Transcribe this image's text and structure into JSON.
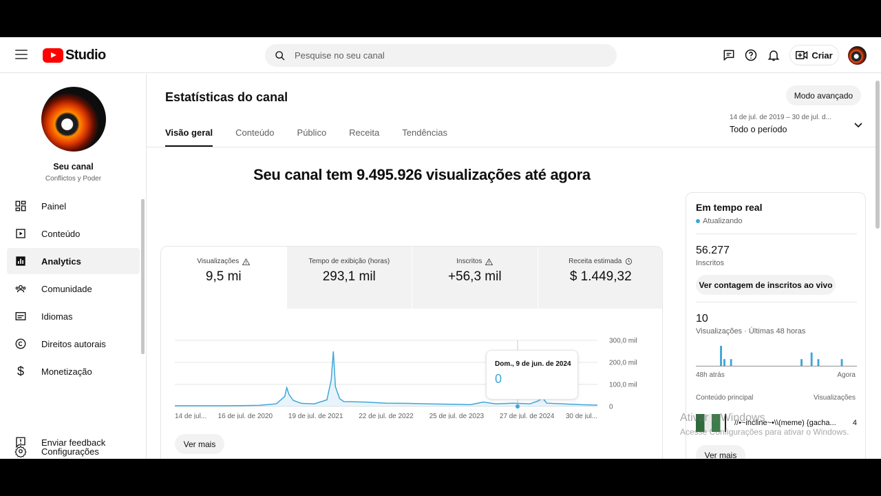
{
  "header": {
    "logo_text": "Studio",
    "search_placeholder": "Pesquise no seu canal",
    "create_label": "Criar"
  },
  "sidebar": {
    "channel_name": "Seu canal",
    "channel_subtitle": "Conflictos y Poder",
    "items": [
      {
        "label": "Painel",
        "icon": "dashboard-icon"
      },
      {
        "label": "Conteúdo",
        "icon": "content-icon"
      },
      {
        "label": "Analytics",
        "icon": "analytics-icon",
        "active": true
      },
      {
        "label": "Comunidade",
        "icon": "community-icon"
      },
      {
        "label": "Idiomas",
        "icon": "subtitles-icon"
      },
      {
        "label": "Direitos autorais",
        "icon": "copyright-icon"
      },
      {
        "label": "Monetização",
        "icon": "dollar-icon"
      }
    ],
    "footer_items": [
      {
        "label": "Configurações",
        "icon": "gear-icon"
      },
      {
        "label": "Enviar feedback",
        "icon": "feedback-icon"
      }
    ]
  },
  "main": {
    "title": "Estatísticas do canal",
    "advanced_mode": "Modo avançado",
    "tabs": [
      "Visão geral",
      "Conteúdo",
      "Público",
      "Receita",
      "Tendências"
    ],
    "date_range_detail": "14 de jul. de 2019 – 30 de jul. d...",
    "date_range_label": "Todo o período",
    "headline": "Seu canal tem 9.495.926 visualizações até agora",
    "metrics": [
      {
        "label": "Visualizações",
        "value": "9,5 mi",
        "icon": "warning-icon"
      },
      {
        "label": "Tempo de exibição (horas)",
        "value": "293,1 mil"
      },
      {
        "label": "Inscritos",
        "value": "+56,3 mil",
        "icon": "warning-icon"
      },
      {
        "label": "Receita estimada",
        "value": "$ 1.449,32",
        "icon": "clock-icon"
      }
    ],
    "see_more": "Ver mais",
    "tooltip": {
      "date": "Dom., 9 de jun. de 2024",
      "value": "0"
    }
  },
  "chart_data": {
    "type": "line",
    "series_color": "#3ea6d9",
    "x_tick_labels": [
      "14 de jul...",
      "16 de jul. de 2020",
      "19 de jul. de 2021",
      "22 de jul. de 2022",
      "25 de jul. de 2023",
      "27 de jul. de 2024",
      "30 de jul..."
    ],
    "y_tick_labels": [
      "300,0 mil",
      "200,0 mil",
      "100,0 mil",
      "0"
    ],
    "ylim": [
      0,
      300000
    ],
    "x": [
      0.0,
      0.04,
      0.08,
      0.12,
      0.16,
      0.2,
      0.24,
      0.26,
      0.265,
      0.27,
      0.28,
      0.29,
      0.3,
      0.33,
      0.36,
      0.37,
      0.375,
      0.38,
      0.39,
      0.4,
      0.45,
      0.5,
      0.55,
      0.6,
      0.65,
      0.7,
      0.73,
      0.76,
      0.8,
      0.84,
      0.86,
      0.87,
      0.88,
      0.92,
      0.96,
      1.0
    ],
    "values": [
      3000,
      3000,
      3000,
      3000,
      4000,
      5000,
      12000,
      45000,
      85000,
      55000,
      28000,
      20000,
      14000,
      12000,
      30000,
      120000,
      250000,
      90000,
      35000,
      22000,
      20000,
      15000,
      14000,
      12000,
      10000,
      8000,
      20000,
      12000,
      15000,
      12000,
      25000,
      40000,
      15000,
      12000,
      8000,
      6000
    ]
  },
  "realtime": {
    "title": "Em tempo real",
    "status": "Atualizando",
    "subscribers": "56.277",
    "subscribers_label": "Inscritos",
    "live_count_button": "Ver contagem de inscritos ao vivo",
    "views": "10",
    "views_label": "Visualizações · Últimas 48 horas",
    "axis_start": "48h atrás",
    "axis_end": "Agora",
    "bars": [
      0,
      0,
      0,
      0,
      0,
      0,
      0,
      3,
      1,
      0,
      1,
      0,
      0,
      0,
      0,
      0,
      0,
      0,
      0,
      0,
      0,
      0,
      0,
      0,
      0,
      0,
      0,
      0,
      0,
      0,
      0,
      1,
      0,
      0,
      2,
      0,
      1,
      0,
      0,
      0,
      0,
      0,
      0,
      1,
      0,
      0,
      0,
      0
    ],
    "top_content_label": "Conteúdo principal",
    "top_views_label": "Visualizações",
    "top_item_title": "//•~incline~•\\\\(meme) {gacha...",
    "top_item_views": "4",
    "see_more": "Ver mais"
  },
  "watermark": {
    "line1": "Ativar o Windows",
    "line2": "Acesse Configurações para ativar o Windows."
  }
}
